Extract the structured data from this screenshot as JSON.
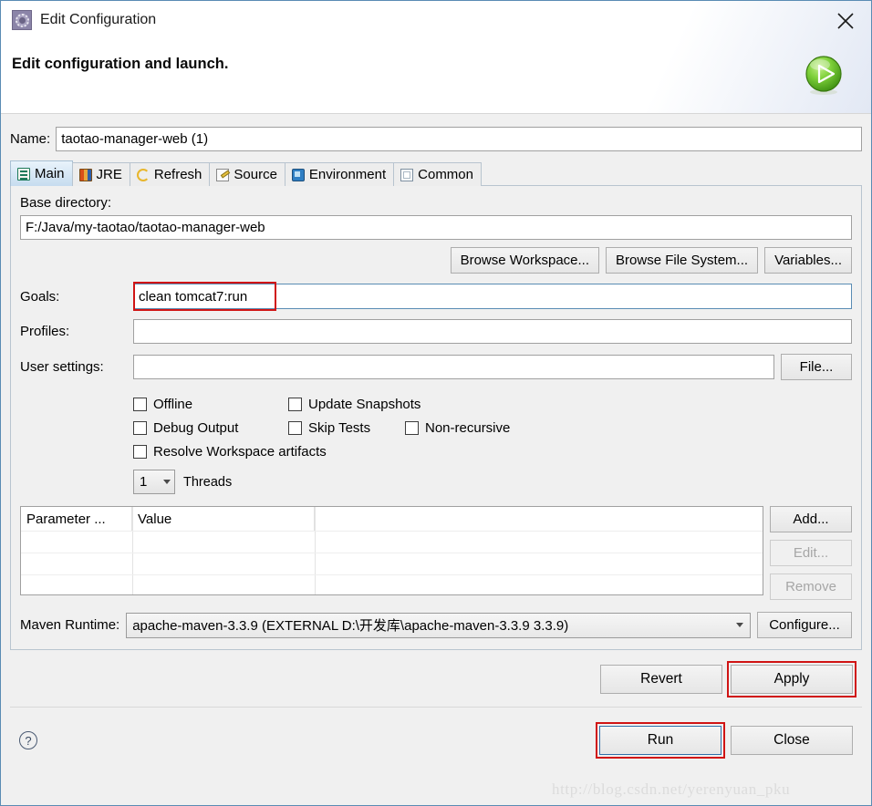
{
  "window": {
    "title": "Edit Configuration",
    "subtitle": "Edit configuration and launch.",
    "icon": "gear-icon",
    "close_icon": "close-icon",
    "run_icon": "run-play-icon"
  },
  "name_field": {
    "label": "Name:",
    "value": "taotao-manager-web (1)"
  },
  "tabs": [
    {
      "label": "Main",
      "icon": "clipboard-icon",
      "active": true
    },
    {
      "label": "JRE",
      "icon": "jre-books-icon",
      "active": false
    },
    {
      "label": "Refresh",
      "icon": "refresh-icon",
      "active": false
    },
    {
      "label": "Source",
      "icon": "source-pencil-icon",
      "active": false
    },
    {
      "label": "Environment",
      "icon": "environment-icon",
      "active": false
    },
    {
      "label": "Common",
      "icon": "common-window-icon",
      "active": false
    }
  ],
  "main_tab": {
    "base_directory": {
      "label": "Base directory:",
      "value": "F:/Java/my-taotao/taotao-manager-web"
    },
    "browse_buttons": [
      "Browse Workspace...",
      "Browse File System...",
      "Variables..."
    ],
    "goals": {
      "label": "Goals:",
      "value": "clean tomcat7:run",
      "highlighted": true
    },
    "profiles": {
      "label": "Profiles:",
      "value": ""
    },
    "user_settings": {
      "label": "User settings:",
      "value": "",
      "button": "File..."
    },
    "checkboxes": [
      [
        {
          "label": "Offline",
          "checked": false
        },
        {
          "label": "Update Snapshots",
          "checked": false
        }
      ],
      [
        {
          "label": "Debug Output",
          "checked": false
        },
        {
          "label": "Skip Tests",
          "checked": false
        },
        {
          "label": "Non-recursive",
          "checked": false
        }
      ],
      [
        {
          "label": "Resolve Workspace artifacts",
          "checked": false
        }
      ]
    ],
    "threads": {
      "value": "1",
      "label": "Threads"
    },
    "parameter_table": {
      "columns": [
        "Parameter ...",
        "Value",
        ""
      ],
      "rows": []
    },
    "table_buttons": [
      {
        "label": "Add...",
        "enabled": true
      },
      {
        "label": "Edit...",
        "enabled": false
      },
      {
        "label": "Remove",
        "enabled": false
      }
    ],
    "maven_runtime": {
      "label": "Maven Runtime:",
      "value": "apache-maven-3.3.9 (EXTERNAL D:\\开发库\\apache-maven-3.3.9 3.3.9)",
      "button": "Configure..."
    }
  },
  "apply_row": {
    "revert": "Revert",
    "apply": "Apply",
    "apply_highlighted": true
  },
  "footer": {
    "help_icon": "help-question-icon",
    "run": "Run",
    "close": "Close",
    "run_highlighted": true
  },
  "watermark": "http://blog.csdn.net/yerenyuan_pku",
  "colors": {
    "dialog_border": "#5a8cb4",
    "header_bg": "#ffffff",
    "body_bg": "#f0f0f0",
    "active_tab": "#c6dcef",
    "annotation_red": "#d01414",
    "focus_blue": "#2f6fa8",
    "run_green": "#5ab82e"
  }
}
